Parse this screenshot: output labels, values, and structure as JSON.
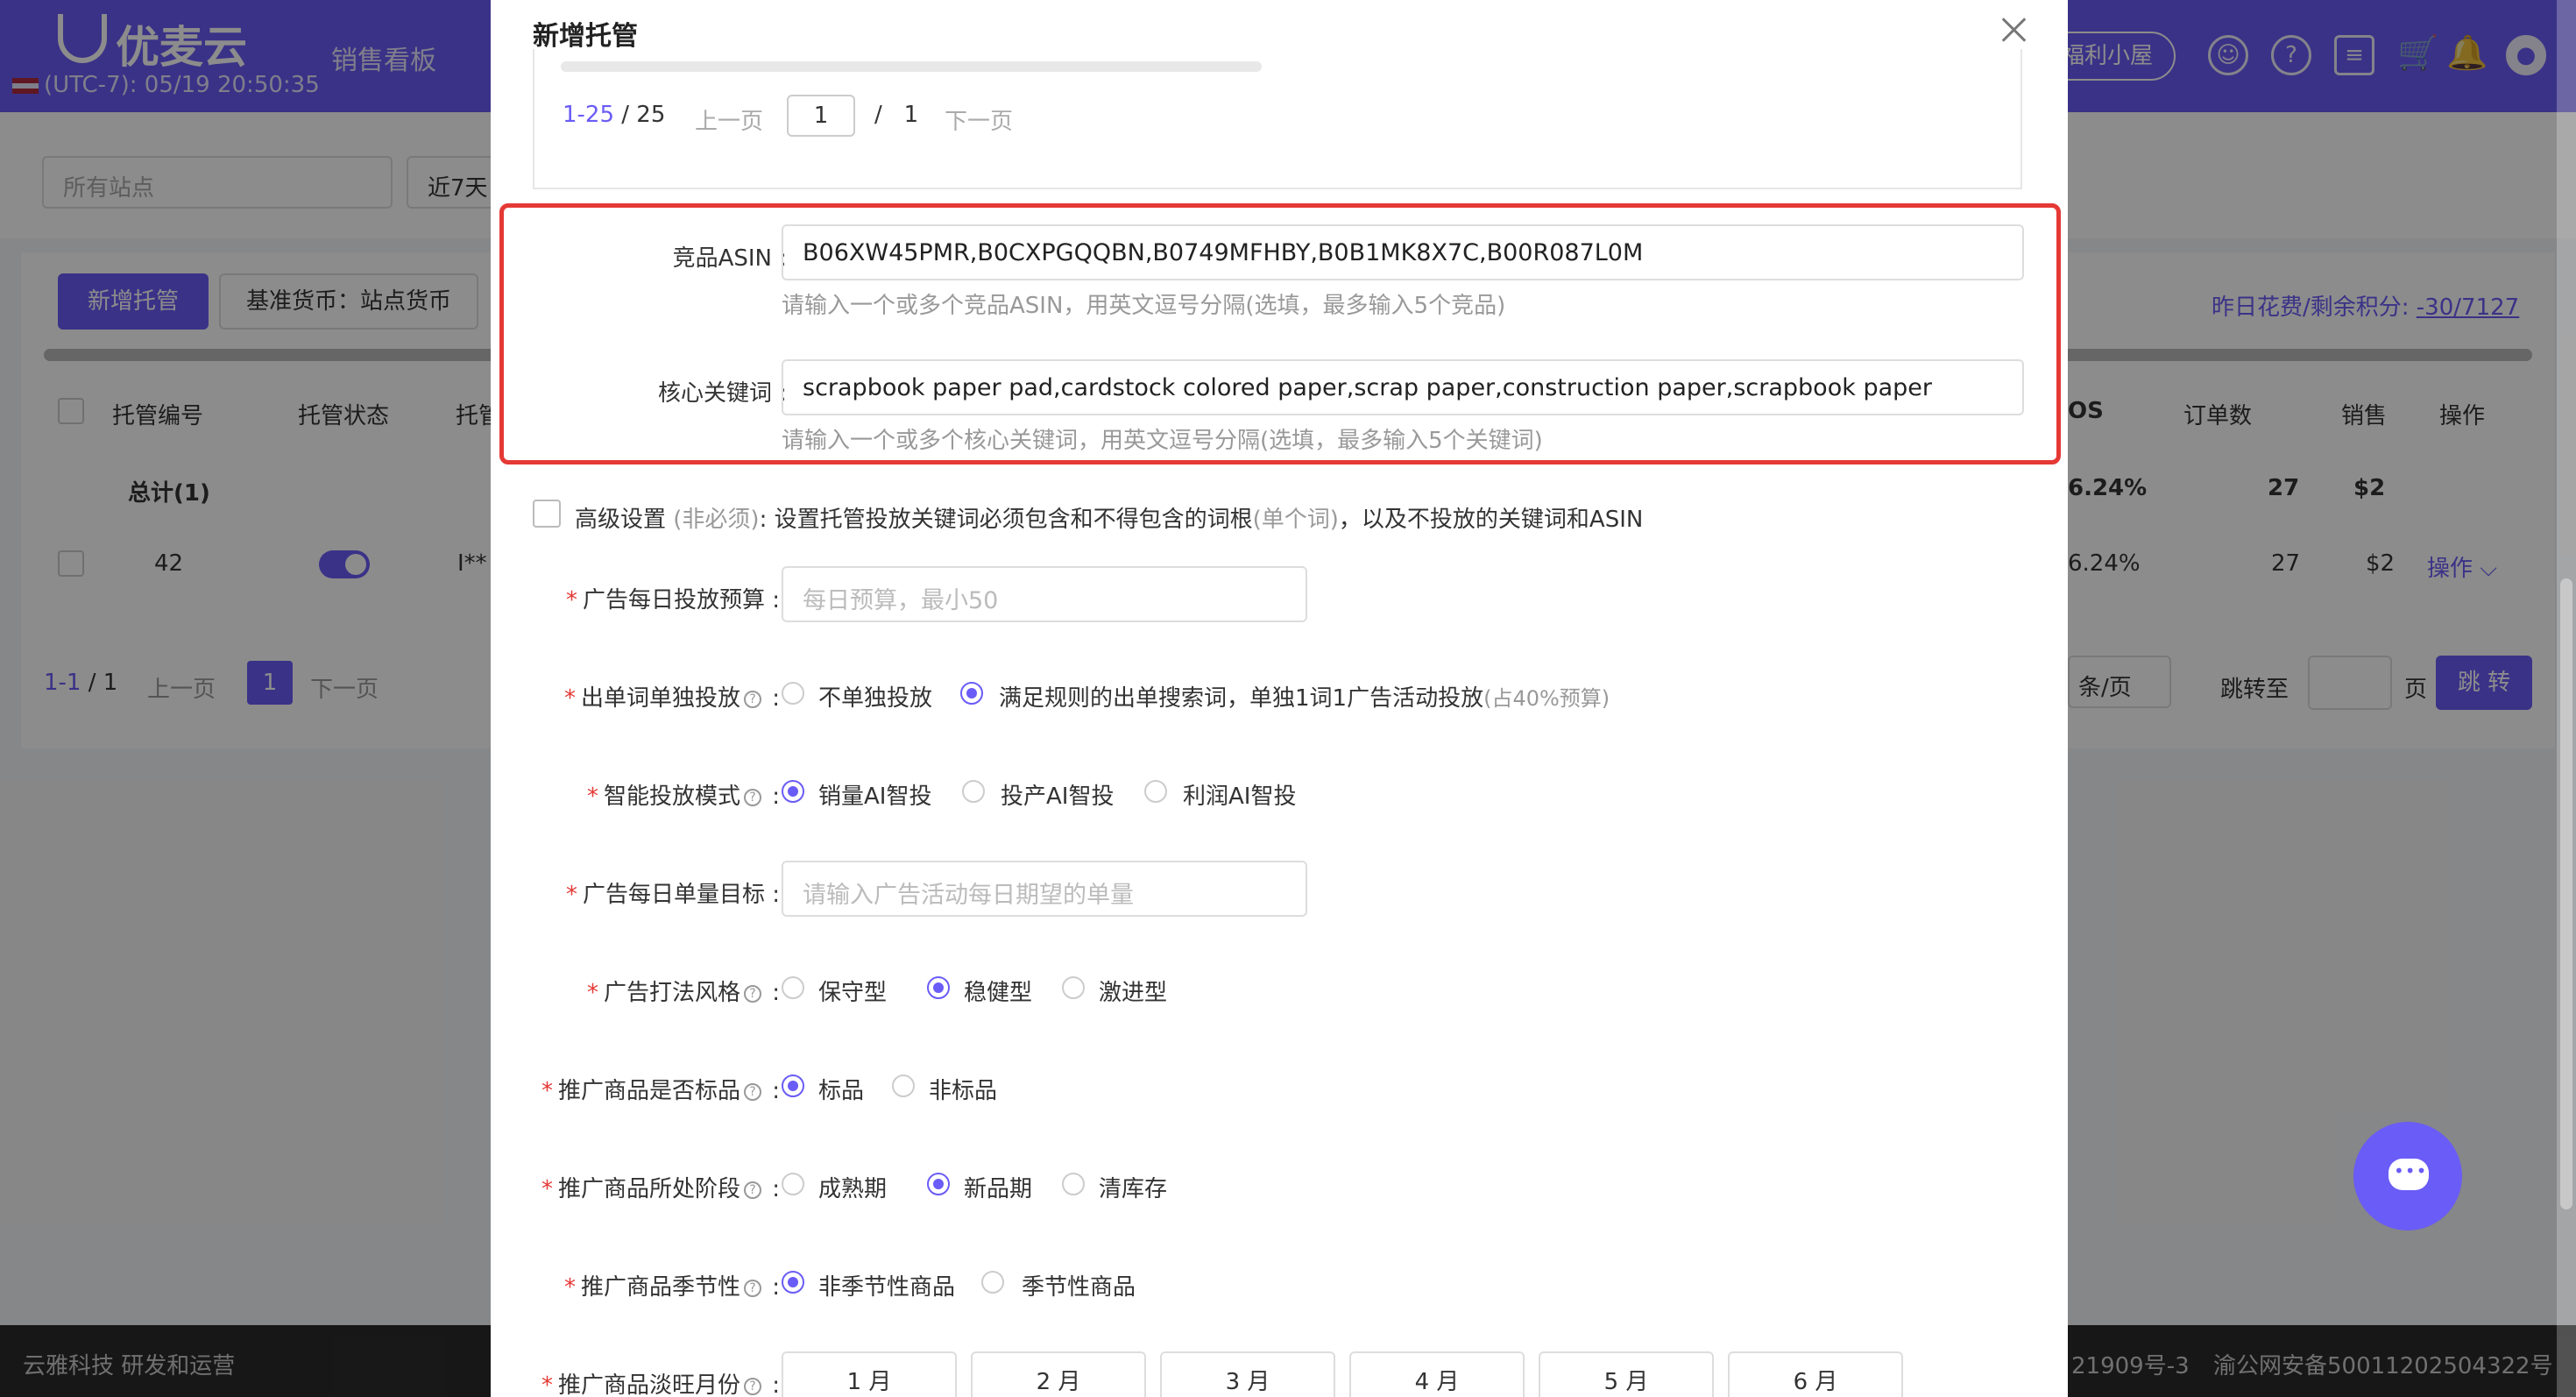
{
  "header": {
    "logo_text": "优麦云",
    "clock": "(UTC-7): 05/19 20:50:35",
    "nav_sales": "销售看板",
    "welfare": "福利小屋"
  },
  "filters": {
    "site": "所有站点",
    "date": "近7天"
  },
  "toolbar": {
    "add_label": "新增托管",
    "currency_label": "基准货币：站点货币",
    "credits_label": "昨日花费/剩余积分:",
    "credits_value": "-30/7127"
  },
  "table": {
    "headers": {
      "id": "托管编号",
      "status": "托管状态",
      "col3": "托管",
      "acos": "OS",
      "orders": "订单数",
      "sales": "销售",
      "ops": "操作"
    },
    "total_row": {
      "label": "总计(1)",
      "acos": "6.24%",
      "orders": "27",
      "sales": "$2"
    },
    "row": {
      "id": "42",
      "name": "I**",
      "acos": "6.24%",
      "orders": "27",
      "sales": "$2",
      "ops": "操作"
    }
  },
  "pager": {
    "range": "1-1",
    "total": "/ 1",
    "prev": "上一页",
    "current": "1",
    "next": "下一页",
    "per_page": "条/页",
    "jump_to": "跳转至",
    "page_unit": "页",
    "jump_btn": "跳 转"
  },
  "footer": {
    "left": "云雅科技 研发和运营",
    "icp": "21909号-3",
    "security": "渝公网安备50011202504322号"
  },
  "modal": {
    "title": "新增托管",
    "pagination": {
      "range": "1-25",
      "total": "/ 25",
      "prev": "上一页",
      "page_input": "1",
      "slash": "/",
      "page_total": "1",
      "next": "下一页"
    },
    "asin": {
      "label": "竞品ASIN :",
      "value": "B06XW45PMR,B0CXPGQQBN,B0749MFHBY,B0B1MK8X7C,B00R087L0M",
      "hint": "请输入一个或多个竞品ASIN，用英文逗号分隔(选填，最多输入5个竞品)"
    },
    "keywords": {
      "label": "核心关键词 :",
      "value": "scrapbook paper pad,cardstock colored paper,scrap paper,construction paper,scrapbook paper",
      "hint": "请输入一个或多个核心关键词，用英文逗号分隔(选填，最多输入5个关键词)"
    },
    "advanced": {
      "label": "高级设置",
      "optional": "(非必须)",
      "desc1": ": 设置托管投放关键词必须包含和不得包含的词根",
      "single": "(单个词)",
      "desc2": "，以及不投放的关键词和ASIN"
    },
    "budget": {
      "label": "广告每日投放预算 :",
      "placeholder": "每日预算，最小50"
    },
    "single_word": {
      "label": "出单词单独投放",
      "opt1": "不单独投放",
      "opt2": "满足规则的出单搜索词，单独1词1广告活动投放",
      "opt2_note": "(占40%预算)",
      "selected": "opt2"
    },
    "mode": {
      "label": "智能投放模式",
      "opt1": "销量AI智投",
      "opt2": "投产AI智投",
      "opt3": "利润AI智投",
      "selected": "opt1"
    },
    "daily_target": {
      "label": "广告每日单量目标 :",
      "placeholder": "请输入广告活动每日期望的单量"
    },
    "style": {
      "label": "广告打法风格",
      "opt1": "保守型",
      "opt2": "稳健型",
      "opt3": "激进型",
      "selected": "opt2"
    },
    "standard": {
      "label": "推广商品是否标品",
      "opt1": "标品",
      "opt2": "非标品",
      "selected": "opt1"
    },
    "stage": {
      "label": "推广商品所处阶段",
      "opt1": "成熟期",
      "opt2": "新品期",
      "opt3": "清库存",
      "selected": "opt2"
    },
    "seasonal": {
      "label": "推广商品季节性",
      "opt1": "非季节性商品",
      "opt2": "季节性商品",
      "selected": "opt1"
    },
    "off_months": {
      "label": "推广商品淡旺月份",
      "months": [
        "1  月",
        "2  月",
        "3  月",
        "4  月",
        "5  月",
        "6  月"
      ]
    }
  },
  "colors": {
    "brand": "#6a5cf6",
    "highlight_border": "#e53935"
  },
  "icons": {
    "close": "close-icon",
    "chat": "chat-icon",
    "help": "question-circle-icon"
  }
}
